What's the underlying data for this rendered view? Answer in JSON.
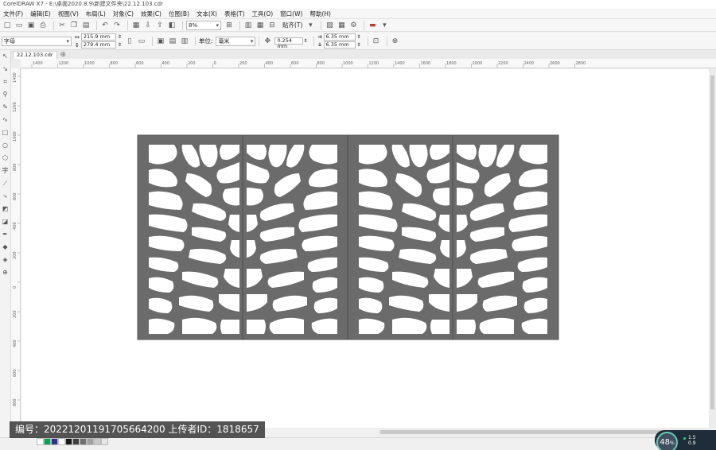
{
  "window": {
    "title": "CorelDRAW X7 - E:\\桌面2020.8.9\\新建文件夹\\22.12.103.cdr"
  },
  "menu": [
    "文件(F)",
    "编辑(E)",
    "视图(V)",
    "布局(L)",
    "对象(C)",
    "效果(C)",
    "位图(B)",
    "文本(X)",
    "表格(T)",
    "工具(O)",
    "窗口(W)",
    "帮助(H)"
  ],
  "toolbar1": {
    "zoom_value": "8%",
    "snap_label": "贴齐(T)",
    "icons": [
      "new-icon",
      "open-icon",
      "save-icon",
      "print-icon",
      "cut-icon",
      "copy-icon",
      "paste-icon",
      "undo-icon",
      "redo-icon",
      "import-icon",
      "export-icon",
      "publish-icon"
    ]
  },
  "toolbar2": {
    "preset_value": "字母",
    "width_value": "215.9 mm",
    "height_value": "279.4 mm",
    "units_label": "单位:",
    "units_value": "毫米",
    "nudge_value": "0.254 mm",
    "dup_x_value": "6.35 mm",
    "dup_y_value": "6.35 mm"
  },
  "document_tab": {
    "name": "22.12.103.cdr"
  },
  "rulers": {
    "h_labels": [
      "1400",
      "1200",
      "1000",
      "800",
      "600",
      "400",
      "200",
      "0",
      "200",
      "400",
      "600",
      "800",
      "1000",
      "1200",
      "1400",
      "1600",
      "1800",
      "2000",
      "2200",
      "2400",
      "2600",
      "2800"
    ],
    "v_labels": [
      "1400",
      "1200",
      "1000",
      "800",
      "600",
      "400",
      "200",
      "0",
      "200",
      "400",
      "600",
      "800"
    ]
  },
  "watermark": {
    "text": "编号：20221201191705664200 上传者ID：1818657"
  },
  "perf": {
    "percent": "48",
    "unit": "%",
    "upload": "1.5",
    "download": "0.9"
  },
  "palette": [
    "#ffffff",
    "#00a651",
    "#2e3192",
    "#ffffff",
    "#1a1a1a",
    "#404040",
    "#707070",
    "#a0a0a0",
    "#c8c8c8",
    "#e6e6e6"
  ],
  "colors": {
    "panel_fill": "#6b6b6b",
    "hole_fill": "#ffffff",
    "canvas": "#ffffff"
  }
}
